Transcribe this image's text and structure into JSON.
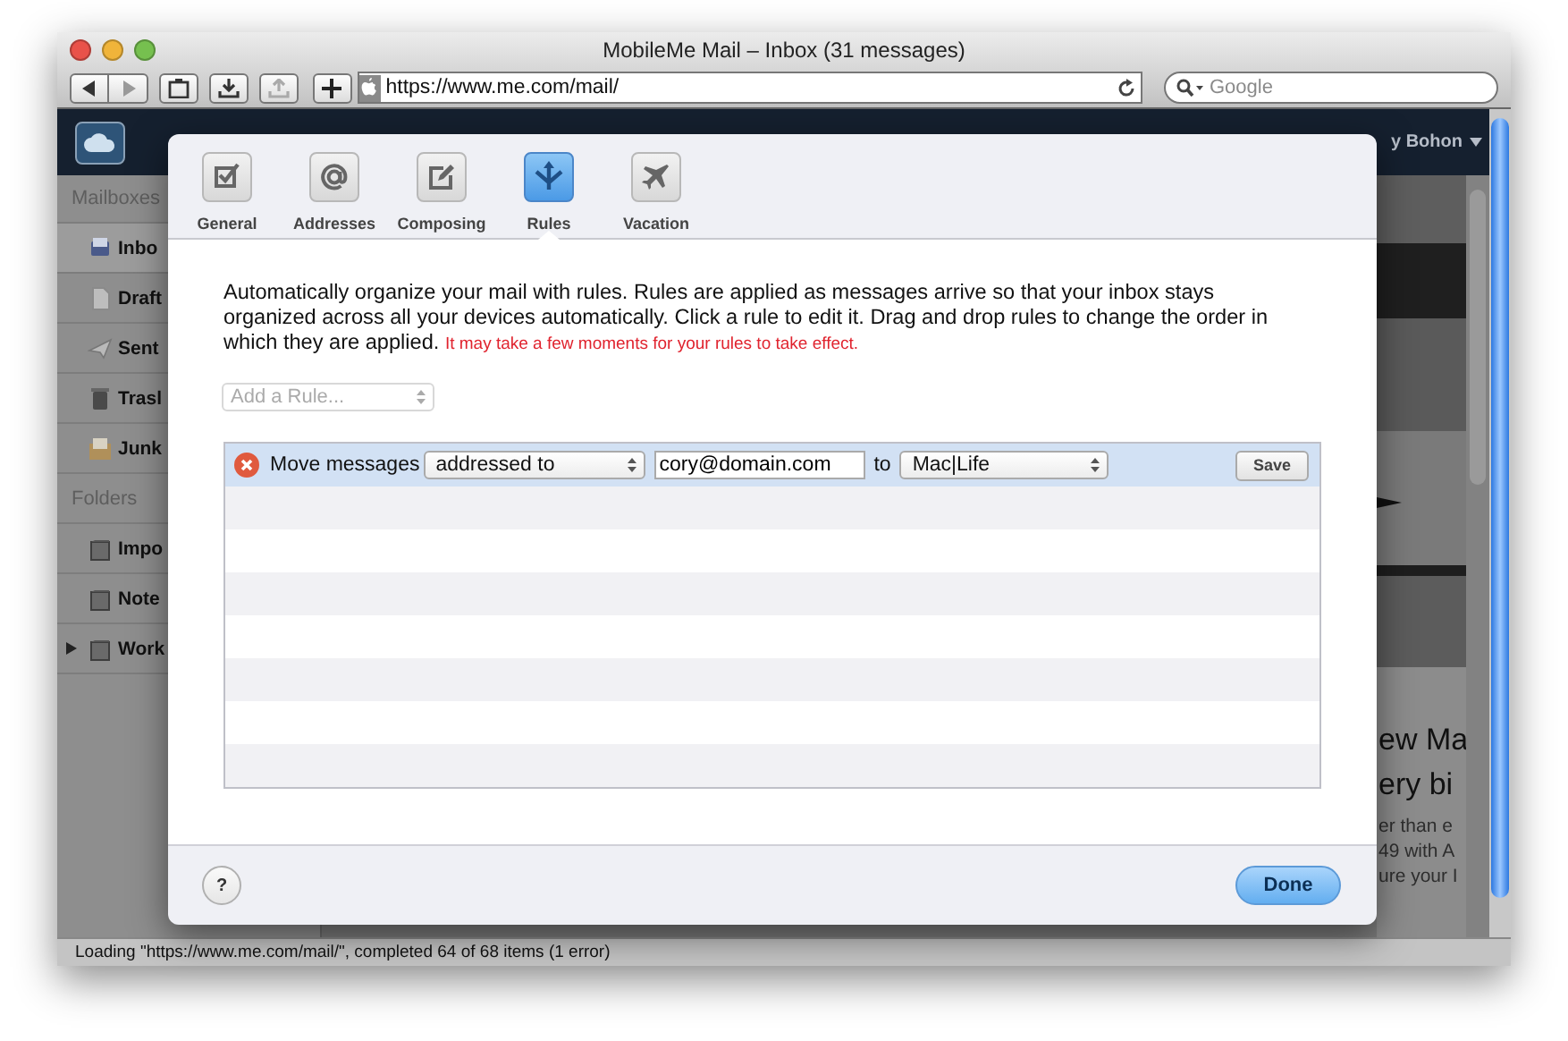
{
  "window": {
    "title": "MobileMe Mail – Inbox (31 messages)"
  },
  "toolbar": {
    "url": "https://www.me.com/mail/",
    "search_placeholder": "Google",
    "upload_disabled": true
  },
  "app_header": {
    "user": "y Bohon"
  },
  "sidebar": {
    "sections": [
      {
        "heading": "Mailboxes",
        "items": [
          {
            "label": "Inbo",
            "kind": "inbox",
            "selected": true
          },
          {
            "label": "Draft",
            "kind": "drafts",
            "selected": false
          },
          {
            "label": "Sent",
            "kind": "sent",
            "selected": false
          },
          {
            "label": "Trasl",
            "kind": "trash",
            "selected": false
          },
          {
            "label": "Junk",
            "kind": "junk",
            "selected": false
          }
        ]
      },
      {
        "heading": "Folders",
        "items": [
          {
            "label": "Impo",
            "kind": "folder",
            "selected": false
          },
          {
            "label": "Note",
            "kind": "folder",
            "selected": false
          },
          {
            "label": "Work",
            "kind": "folder",
            "selected": false,
            "expanded": false
          }
        ]
      }
    ]
  },
  "article": {
    "headline": [
      "ew Ma",
      "ery bi"
    ],
    "body": [
      "er than e",
      "49 with A",
      "ure your I"
    ]
  },
  "preferences": {
    "tabs": [
      {
        "label": "General",
        "kind": "general",
        "selected": false
      },
      {
        "label": "Addresses",
        "kind": "addresses",
        "selected": false
      },
      {
        "label": "Composing",
        "kind": "composing",
        "selected": false
      },
      {
        "label": "Rules",
        "kind": "rules",
        "selected": true
      },
      {
        "label": "Vacation",
        "kind": "vacation",
        "selected": false
      }
    ],
    "description": "Automatically organize your mail with rules. Rules are applied as messages arrive so that your inbox stays organized across all your devices automatically. Click a rule to edit it. Drag and drop rules to change the order in which they are applied.",
    "note": "It may take a few moments for your rules to take effect.",
    "add_rule": {
      "placeholder": "Add a Rule..."
    },
    "rules": [
      {
        "action": "Move messages",
        "condition": "addressed to",
        "value": "cory@domain.com",
        "connector": "to",
        "target": "Mac|Life",
        "save": "Save",
        "selected": true
      }
    ],
    "help": "?",
    "done": "Done"
  },
  "status_bar": "Loading \"https://www.me.com/mail/\", completed 64 of 68 items (1 error)"
}
